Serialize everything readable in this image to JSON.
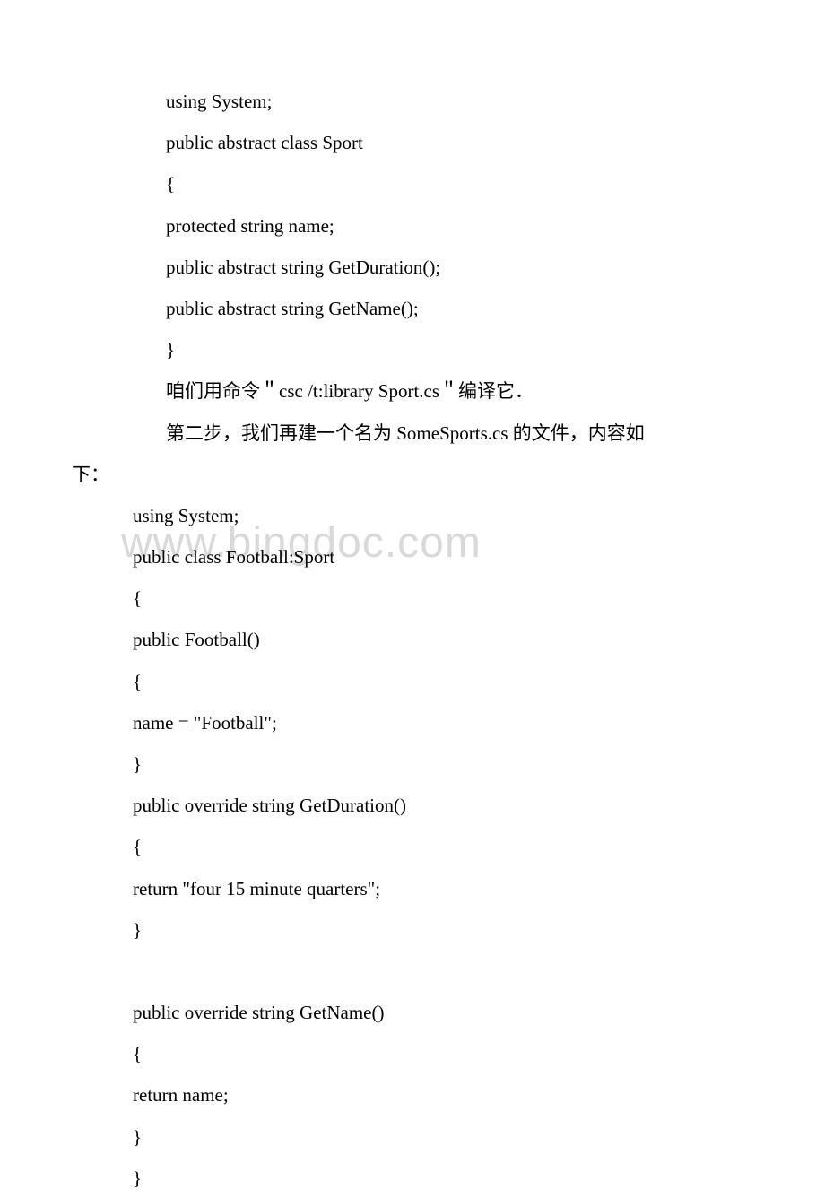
{
  "watermark": "www.bingdoc.com",
  "lines": [
    {
      "cls": "indent-deep",
      "text": "using System;"
    },
    {
      "cls": "indent-deep",
      "text": "public abstract class Sport"
    },
    {
      "cls": "indent-deep",
      "text": "{"
    },
    {
      "cls": "indent-deep",
      "text": "  protected string name;"
    },
    {
      "cls": "indent-deep",
      "text": " public abstract string GetDuration();"
    },
    {
      "cls": "indent-deep",
      "text": " public abstract string GetName();"
    },
    {
      "cls": "indent-deep",
      "text": "}"
    },
    {
      "cls": "indent-deep",
      "text": "咱们用命令＂csc /t:library Sport.cs＂编译它．"
    },
    {
      "cls": "indent-deep",
      "text": "第二步，我们再建一个名为 SomeSports.cs 的文件，内容如"
    },
    {
      "cls": "indent-left",
      "text": "下："
    },
    {
      "cls": "indent-medium",
      "text": "using System;"
    },
    {
      "cls": "indent-medium",
      "text": "public class Football:Sport"
    },
    {
      "cls": "indent-medium",
      "text": "{"
    },
    {
      "cls": "indent-medium",
      "text": " public Football()"
    },
    {
      "cls": "indent-medium",
      "text": " {"
    },
    {
      "cls": "indent-medium",
      "text": " name = \"Football\";"
    },
    {
      "cls": "indent-medium",
      "text": " }"
    },
    {
      "cls": "indent-medium",
      "text": " public override string GetDuration()"
    },
    {
      "cls": "indent-medium",
      "text": " {"
    },
    {
      "cls": "indent-medium",
      "text": " return \"four 15 minute quarters\";"
    },
    {
      "cls": "indent-medium",
      "text": " }"
    },
    {
      "cls": "blank",
      "text": ""
    },
    {
      "cls": "indent-medium",
      "text": " public override string GetName()"
    },
    {
      "cls": "indent-medium",
      "text": " {"
    },
    {
      "cls": "indent-medium",
      "text": " return name;"
    },
    {
      "cls": "indent-medium",
      "text": " }"
    },
    {
      "cls": "indent-medium",
      "text": "}"
    }
  ]
}
